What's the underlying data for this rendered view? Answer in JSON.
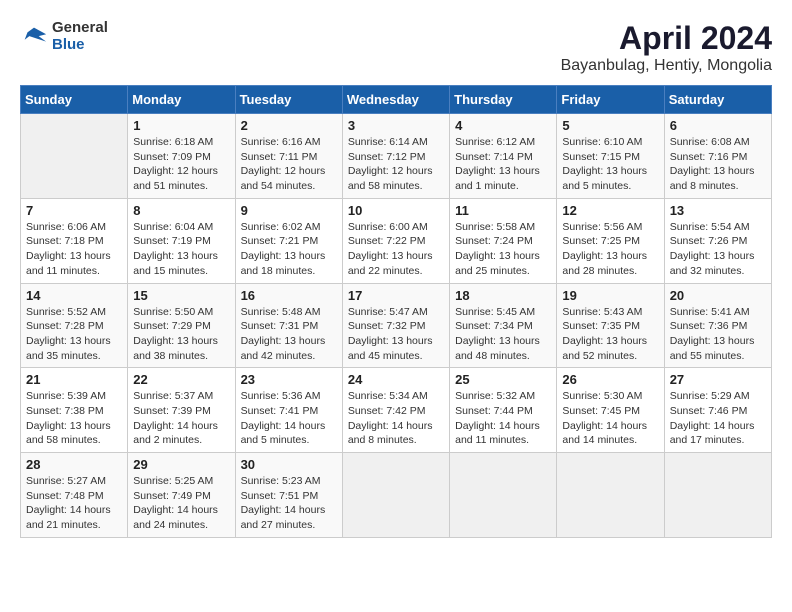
{
  "header": {
    "logo_general": "General",
    "logo_blue": "Blue",
    "title": "April 2024",
    "subtitle": "Bayanbulag, Hentiy, Mongolia"
  },
  "calendar": {
    "headers": [
      "Sunday",
      "Monday",
      "Tuesday",
      "Wednesday",
      "Thursday",
      "Friday",
      "Saturday"
    ],
    "weeks": [
      [
        {
          "day": "",
          "info": ""
        },
        {
          "day": "1",
          "info": "Sunrise: 6:18 AM\nSunset: 7:09 PM\nDaylight: 12 hours\nand 51 minutes."
        },
        {
          "day": "2",
          "info": "Sunrise: 6:16 AM\nSunset: 7:11 PM\nDaylight: 12 hours\nand 54 minutes."
        },
        {
          "day": "3",
          "info": "Sunrise: 6:14 AM\nSunset: 7:12 PM\nDaylight: 12 hours\nand 58 minutes."
        },
        {
          "day": "4",
          "info": "Sunrise: 6:12 AM\nSunset: 7:14 PM\nDaylight: 13 hours\nand 1 minute."
        },
        {
          "day": "5",
          "info": "Sunrise: 6:10 AM\nSunset: 7:15 PM\nDaylight: 13 hours\nand 5 minutes."
        },
        {
          "day": "6",
          "info": "Sunrise: 6:08 AM\nSunset: 7:16 PM\nDaylight: 13 hours\nand 8 minutes."
        }
      ],
      [
        {
          "day": "7",
          "info": "Sunrise: 6:06 AM\nSunset: 7:18 PM\nDaylight: 13 hours\nand 11 minutes."
        },
        {
          "day": "8",
          "info": "Sunrise: 6:04 AM\nSunset: 7:19 PM\nDaylight: 13 hours\nand 15 minutes."
        },
        {
          "day": "9",
          "info": "Sunrise: 6:02 AM\nSunset: 7:21 PM\nDaylight: 13 hours\nand 18 minutes."
        },
        {
          "day": "10",
          "info": "Sunrise: 6:00 AM\nSunset: 7:22 PM\nDaylight: 13 hours\nand 22 minutes."
        },
        {
          "day": "11",
          "info": "Sunrise: 5:58 AM\nSunset: 7:24 PM\nDaylight: 13 hours\nand 25 minutes."
        },
        {
          "day": "12",
          "info": "Sunrise: 5:56 AM\nSunset: 7:25 PM\nDaylight: 13 hours\nand 28 minutes."
        },
        {
          "day": "13",
          "info": "Sunrise: 5:54 AM\nSunset: 7:26 PM\nDaylight: 13 hours\nand 32 minutes."
        }
      ],
      [
        {
          "day": "14",
          "info": "Sunrise: 5:52 AM\nSunset: 7:28 PM\nDaylight: 13 hours\nand 35 minutes."
        },
        {
          "day": "15",
          "info": "Sunrise: 5:50 AM\nSunset: 7:29 PM\nDaylight: 13 hours\nand 38 minutes."
        },
        {
          "day": "16",
          "info": "Sunrise: 5:48 AM\nSunset: 7:31 PM\nDaylight: 13 hours\nand 42 minutes."
        },
        {
          "day": "17",
          "info": "Sunrise: 5:47 AM\nSunset: 7:32 PM\nDaylight: 13 hours\nand 45 minutes."
        },
        {
          "day": "18",
          "info": "Sunrise: 5:45 AM\nSunset: 7:34 PM\nDaylight: 13 hours\nand 48 minutes."
        },
        {
          "day": "19",
          "info": "Sunrise: 5:43 AM\nSunset: 7:35 PM\nDaylight: 13 hours\nand 52 minutes."
        },
        {
          "day": "20",
          "info": "Sunrise: 5:41 AM\nSunset: 7:36 PM\nDaylight: 13 hours\nand 55 minutes."
        }
      ],
      [
        {
          "day": "21",
          "info": "Sunrise: 5:39 AM\nSunset: 7:38 PM\nDaylight: 13 hours\nand 58 minutes."
        },
        {
          "day": "22",
          "info": "Sunrise: 5:37 AM\nSunset: 7:39 PM\nDaylight: 14 hours\nand 2 minutes."
        },
        {
          "day": "23",
          "info": "Sunrise: 5:36 AM\nSunset: 7:41 PM\nDaylight: 14 hours\nand 5 minutes."
        },
        {
          "day": "24",
          "info": "Sunrise: 5:34 AM\nSunset: 7:42 PM\nDaylight: 14 hours\nand 8 minutes."
        },
        {
          "day": "25",
          "info": "Sunrise: 5:32 AM\nSunset: 7:44 PM\nDaylight: 14 hours\nand 11 minutes."
        },
        {
          "day": "26",
          "info": "Sunrise: 5:30 AM\nSunset: 7:45 PM\nDaylight: 14 hours\nand 14 minutes."
        },
        {
          "day": "27",
          "info": "Sunrise: 5:29 AM\nSunset: 7:46 PM\nDaylight: 14 hours\nand 17 minutes."
        }
      ],
      [
        {
          "day": "28",
          "info": "Sunrise: 5:27 AM\nSunset: 7:48 PM\nDaylight: 14 hours\nand 21 minutes."
        },
        {
          "day": "29",
          "info": "Sunrise: 5:25 AM\nSunset: 7:49 PM\nDaylight: 14 hours\nand 24 minutes."
        },
        {
          "day": "30",
          "info": "Sunrise: 5:23 AM\nSunset: 7:51 PM\nDaylight: 14 hours\nand 27 minutes."
        },
        {
          "day": "",
          "info": ""
        },
        {
          "day": "",
          "info": ""
        },
        {
          "day": "",
          "info": ""
        },
        {
          "day": "",
          "info": ""
        }
      ]
    ]
  }
}
